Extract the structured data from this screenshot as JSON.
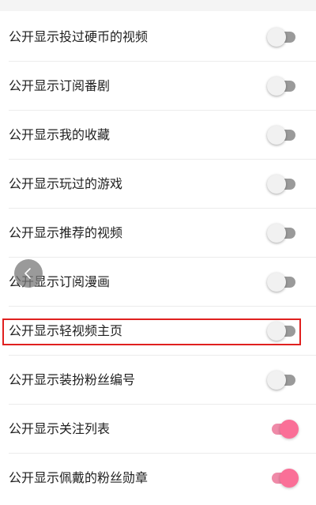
{
  "settings": {
    "rows": [
      {
        "label": "公开显示投过硬币的视频",
        "on": false
      },
      {
        "label": "公开显示订阅番剧",
        "on": false
      },
      {
        "label": "公开显示我的收藏",
        "on": false
      },
      {
        "label": "公开显示玩过的游戏",
        "on": false
      },
      {
        "label": "公开显示推荐的视频",
        "on": false
      },
      {
        "label": "公开显示订阅漫画",
        "on": false
      },
      {
        "label": "公开显示轻视频主页",
        "on": false
      },
      {
        "label": "公开显示装扮粉丝编号",
        "on": false
      },
      {
        "label": "公开显示关注列表",
        "on": true
      },
      {
        "label": "公开显示佩戴的粉丝勋章",
        "on": true
      }
    ]
  },
  "colors": {
    "toggle_on": "#fa6f97",
    "toggle_off_track": "#9a9a9a",
    "highlight": "#e0201f"
  },
  "icons": {
    "floating_back": "chevron-left-icon"
  }
}
